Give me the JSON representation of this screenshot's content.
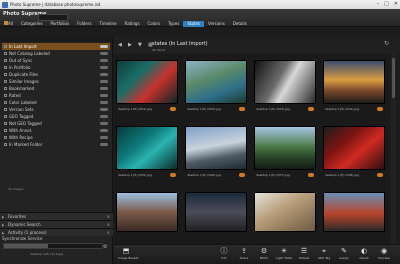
{
  "window": {
    "title": "Photo Supreme | database photosupreme.isd",
    "controls": [
      "–",
      "□",
      "✕"
    ]
  },
  "app": {
    "logo_line1": "Photo Supreme",
    "logo_line2": ""
  },
  "tabs": [
    {
      "label": "All",
      "active": false
    },
    {
      "label": "Categories",
      "active": false
    },
    {
      "label": "Portfolios",
      "active": false
    },
    {
      "label": "Folders",
      "active": false
    },
    {
      "label": "Timeline",
      "active": false
    },
    {
      "label": "Ratings",
      "active": false
    },
    {
      "label": "Colors",
      "active": false
    },
    {
      "label": "Types",
      "active": false
    },
    {
      "label": "States",
      "active": true
    },
    {
      "label": "Versions",
      "active": false
    },
    {
      "label": "Details",
      "active": false
    }
  ],
  "left_panel": {
    "tags": [
      {
        "label": "In Last Import",
        "selected": true
      },
      {
        "label": "Not Catalog Labeled",
        "selected": false
      },
      {
        "label": "Out of Sync",
        "selected": false
      },
      {
        "label": "In Portfolio",
        "selected": false
      },
      {
        "label": "Duplicate Files",
        "selected": false
      },
      {
        "label": "Similar Images",
        "selected": false
      },
      {
        "label": "Bookmarked",
        "selected": false
      },
      {
        "label": "Rated",
        "selected": false
      },
      {
        "label": "Color Labeled",
        "selected": false
      },
      {
        "label": "Version Sets",
        "selected": false
      },
      {
        "label": "GEO Tagged",
        "selected": false
      },
      {
        "label": "Not GEO Tagged",
        "selected": false
      },
      {
        "label": "With Annot.",
        "selected": false
      },
      {
        "label": "With Recipe",
        "selected": false
      },
      {
        "label": "In Marked Folder",
        "selected": false
      }
    ],
    "tagged_count": "42 images",
    "accordions": [
      "Favorites",
      "Dynamic Search",
      "Activity (1 process)"
    ],
    "sync": {
      "title": "Synchronize Service",
      "file": "desktop 1(H) (3) 0.jpg",
      "progress": 0.45
    }
  },
  "center": {
    "title": "states (In Last Import)",
    "subtitle": "42 items",
    "nav_icons": [
      "back-icon",
      "forward-icon",
      "filter-icon",
      "layout-icon"
    ]
  },
  "thumbnails": [
    {
      "file": "desktop 1(H) (001).jpg"
    },
    {
      "file": "desktop 1(H) (002).jpg"
    },
    {
      "file": "desktop 1(H) (003).jpg"
    },
    {
      "file": "desktop 1(H) (004).jpg"
    },
    {
      "file": "desktop 1(H) (005).jpg"
    },
    {
      "file": "desktop 1(H) (006).jpg"
    },
    {
      "file": "desktop 1(H) (007).jpg"
    },
    {
      "file": "desktop 1(H) (008).jpg"
    },
    {
      "file": "",
      "partial": true
    },
    {
      "file": "",
      "partial": true
    },
    {
      "file": "",
      "partial": true
    },
    {
      "file": "",
      "partial": true
    }
  ],
  "toolbar": [
    {
      "label": "Image Basket",
      "icon": "basket-icon"
    },
    {
      "label": "Info",
      "icon": "info-icon"
    },
    {
      "label": "Share",
      "icon": "share-icon"
    },
    {
      "label": "Batch",
      "icon": "batch-icon"
    },
    {
      "label": "Light Table",
      "icon": "light-table-icon"
    },
    {
      "label": "Details",
      "icon": "details-icon"
    },
    {
      "label": "GEO Tag",
      "icon": "geo-tag-icon"
    },
    {
      "label": "Assign",
      "icon": "assign-icon"
    },
    {
      "label": "Adjust",
      "icon": "adjust-icon"
    },
    {
      "label": "Preview",
      "icon": "preview-icon"
    }
  ]
}
